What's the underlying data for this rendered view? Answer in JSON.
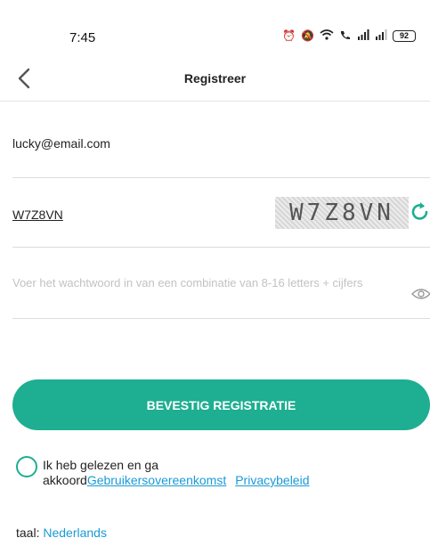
{
  "status_bar": {
    "time": "7:45",
    "battery": "92",
    "icons": [
      "alarm-icon",
      "mute-icon",
      "wifi-icon",
      "call-signal-icon",
      "signal-icon",
      "signal-icon-2",
      "battery-icon"
    ]
  },
  "header": {
    "title": "Registreer"
  },
  "form": {
    "email_value": "lucky@email.com",
    "captcha_value": "W7Z8VN",
    "captcha_image_text": "W7Z8VN",
    "password_placeholder": "Voer het wachtwoord in van een combinatie van 8-16 letters + cijfers",
    "confirm_label": "BEVESTIG REGISTRATIE"
  },
  "agreement": {
    "line1": "Ik heb gelezen en ga",
    "line2_prefix": "akkoord",
    "terms_link": "Gebruikersovereenkomst",
    "privacy_link": "Privacybeleid"
  },
  "language": {
    "label": "taal:",
    "value": "Nederlands"
  },
  "colors": {
    "accent": "#1eae91",
    "link": "#1a9ad6"
  }
}
